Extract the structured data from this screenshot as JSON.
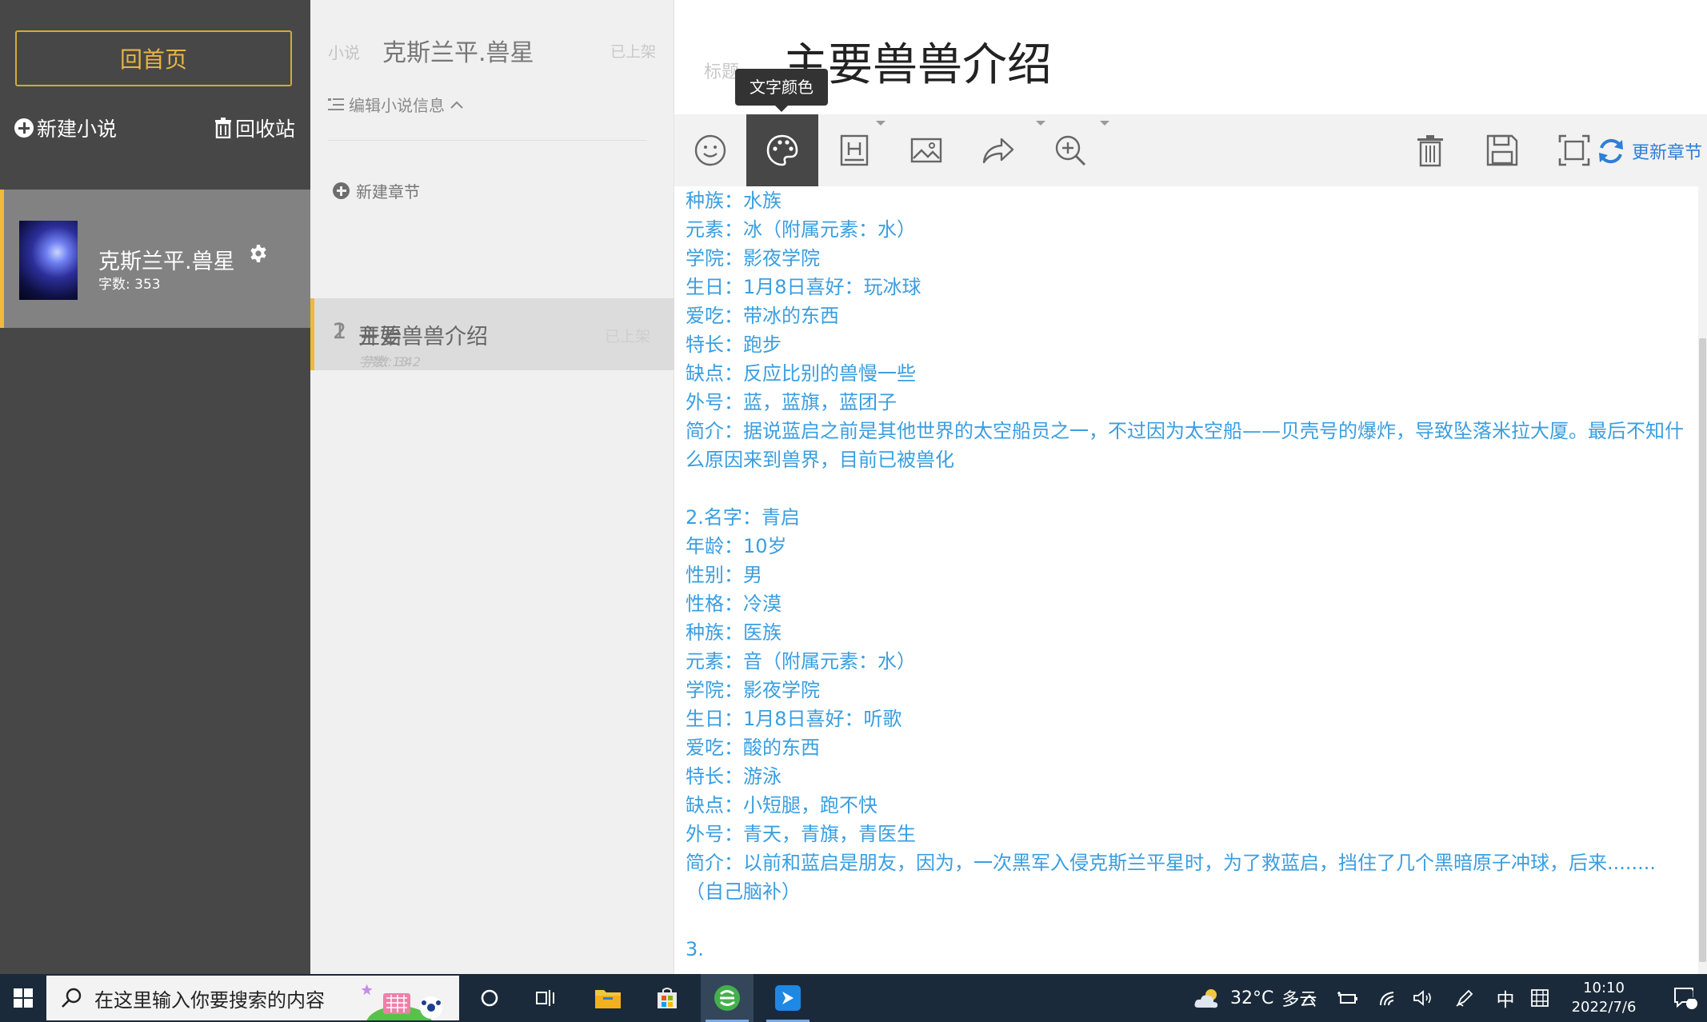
{
  "sidebar": {
    "home_button": "回首页",
    "new_novel": "新建小说",
    "recycle_bin": "回收站",
    "novel": {
      "name": "克斯兰平.兽星",
      "word_count": "字数: 353"
    }
  },
  "chapters_panel": {
    "novel_label": "小说",
    "novel_title": "克斯兰平.兽星",
    "novel_status": "已上架",
    "edit_info": "编辑小说信息",
    "new_chapter": "新建章节",
    "chapters": [
      {
        "num": "2",
        "title": "主要兽兽介绍",
        "status": "已上架",
        "count": "字数: 342",
        "active": true
      },
      {
        "num": "1",
        "title": "开始",
        "status": "已上架",
        "count": "字数: 13",
        "active": false
      }
    ]
  },
  "editor": {
    "title_label": "标题",
    "chapter_title": "主要兽兽介绍",
    "tooltip": "文字颜色",
    "update_button": "更新章节",
    "text_color": "#3a9ee0",
    "lines": [
      "种族：水族",
      "元素：冰（附属元素：水）",
      "学院：影夜学院",
      "生日：1月8日喜好：玩冰球",
      "爱吃：带冰的东西",
      "特长：跑步",
      "缺点：反应比别的兽慢一些",
      "外号：蓝，蓝旗，蓝团子",
      "简介：据说蓝启之前是其他世界的太空船员之一，不过因为太空船——贝壳号的爆炸，导致坠落米拉大厦。最后不知什",
      "么原因来到兽界，目前已被兽化",
      "",
      "2.名字：青启",
      "年龄：10岁",
      "性别：男",
      "性格：冷漠",
      "种族：医族",
      "元素：音（附属元素：水）",
      "学院：影夜学院",
      "生日：1月8日喜好：听歌",
      "爱吃：酸的东西",
      "特长：游泳",
      "缺点：小短腿，跑不快",
      "外号：青天，青旗，青医生",
      "简介：以前和蓝启是朋友，因为，一次黑军入侵克斯兰平星时，为了救蓝启，挡住了几个黑暗原子冲球，后来........",
      "（自己脑补）",
      "",
      "3."
    ]
  },
  "taskbar": {
    "search_placeholder": "在这里输入你要搜索的内容",
    "temperature": "32°C",
    "weather": "多云",
    "ime": "中",
    "time": "10:10",
    "date": "2022/7/6",
    "notification_count": "1"
  }
}
